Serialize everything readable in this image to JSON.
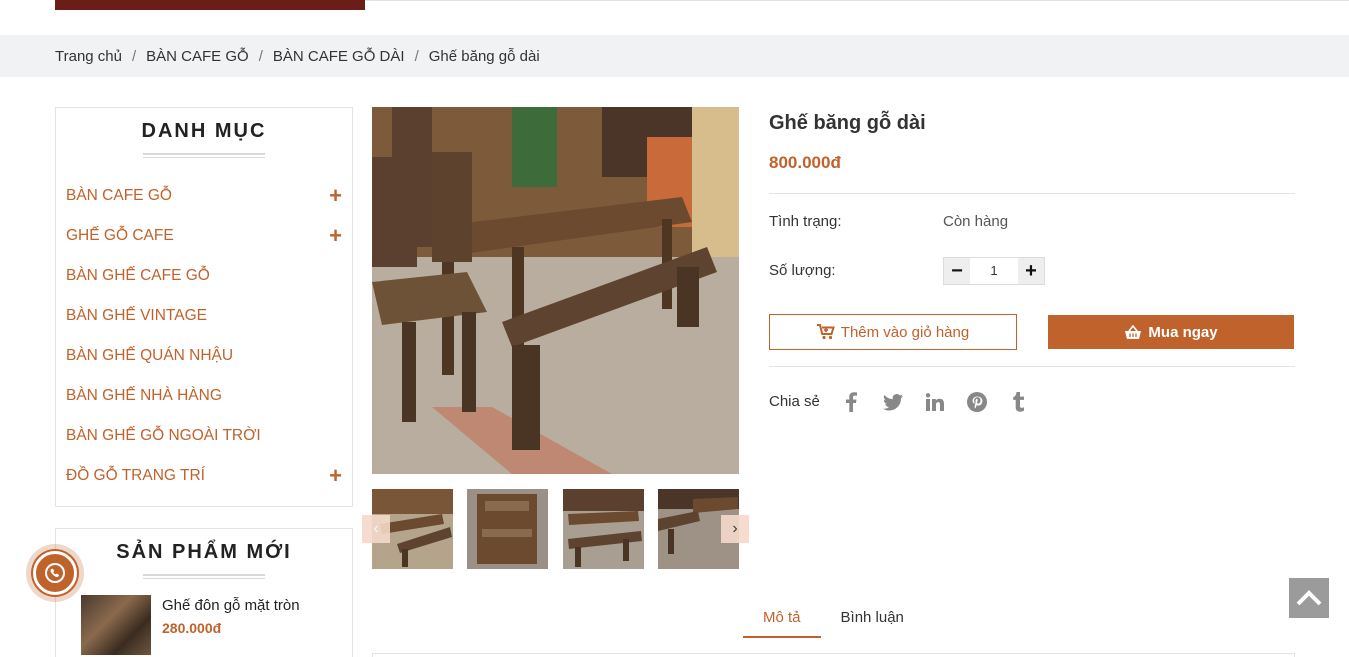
{
  "breadcrumb": {
    "home": "Trang chủ",
    "level1": "BÀN CAFE GỖ",
    "level2": "BÀN CAFE GỖ DÀI",
    "current": "Ghế băng gỗ dài",
    "separator": "/"
  },
  "sidebar": {
    "category_title": "DANH MỤC",
    "categories": [
      {
        "label": "BÀN CAFE GỖ",
        "expandable": true
      },
      {
        "label": "GHẾ GỖ CAFE",
        "expandable": true
      },
      {
        "label": "BÀN GHẾ CAFE GỖ",
        "expandable": false
      },
      {
        "label": "BÀN GHẾ VINTAGE",
        "expandable": false
      },
      {
        "label": "BÀN GHẾ QUÁN NHẬU",
        "expandable": false
      },
      {
        "label": "BÀN GHẾ NHÀ HÀNG",
        "expandable": false
      },
      {
        "label": "BÀN GHẾ GỖ NGOÀI TRỜI",
        "expandable": false
      },
      {
        "label": "ĐỒ GỖ TRANG TRÍ",
        "expandable": true
      }
    ],
    "new_title": "SẢN PHẨM MỚI",
    "new_products": [
      {
        "name": "Ghế đôn gỗ mặt tròn",
        "price": "280.000đ"
      }
    ]
  },
  "product": {
    "title": "Ghế băng gỗ dài",
    "price": "800.000đ",
    "status_label": "Tình trạng:",
    "status_value": "Còn hàng",
    "qty_label": "Số lượng:",
    "qty_value": "1",
    "qty_minus": "−",
    "qty_plus": "+",
    "add_to_cart": "Thêm vào giỏ hàng",
    "buy_now": "Mua ngay",
    "share_label": "Chia sẻ"
  },
  "tabs": [
    {
      "label": "Mô tả",
      "active": true
    },
    {
      "label": "Bình luận",
      "active": false
    }
  ],
  "colors": {
    "accent": "#c0622b",
    "header_bar": "#6b1e17",
    "breadcrumb_bg": "#f1f2f4"
  }
}
